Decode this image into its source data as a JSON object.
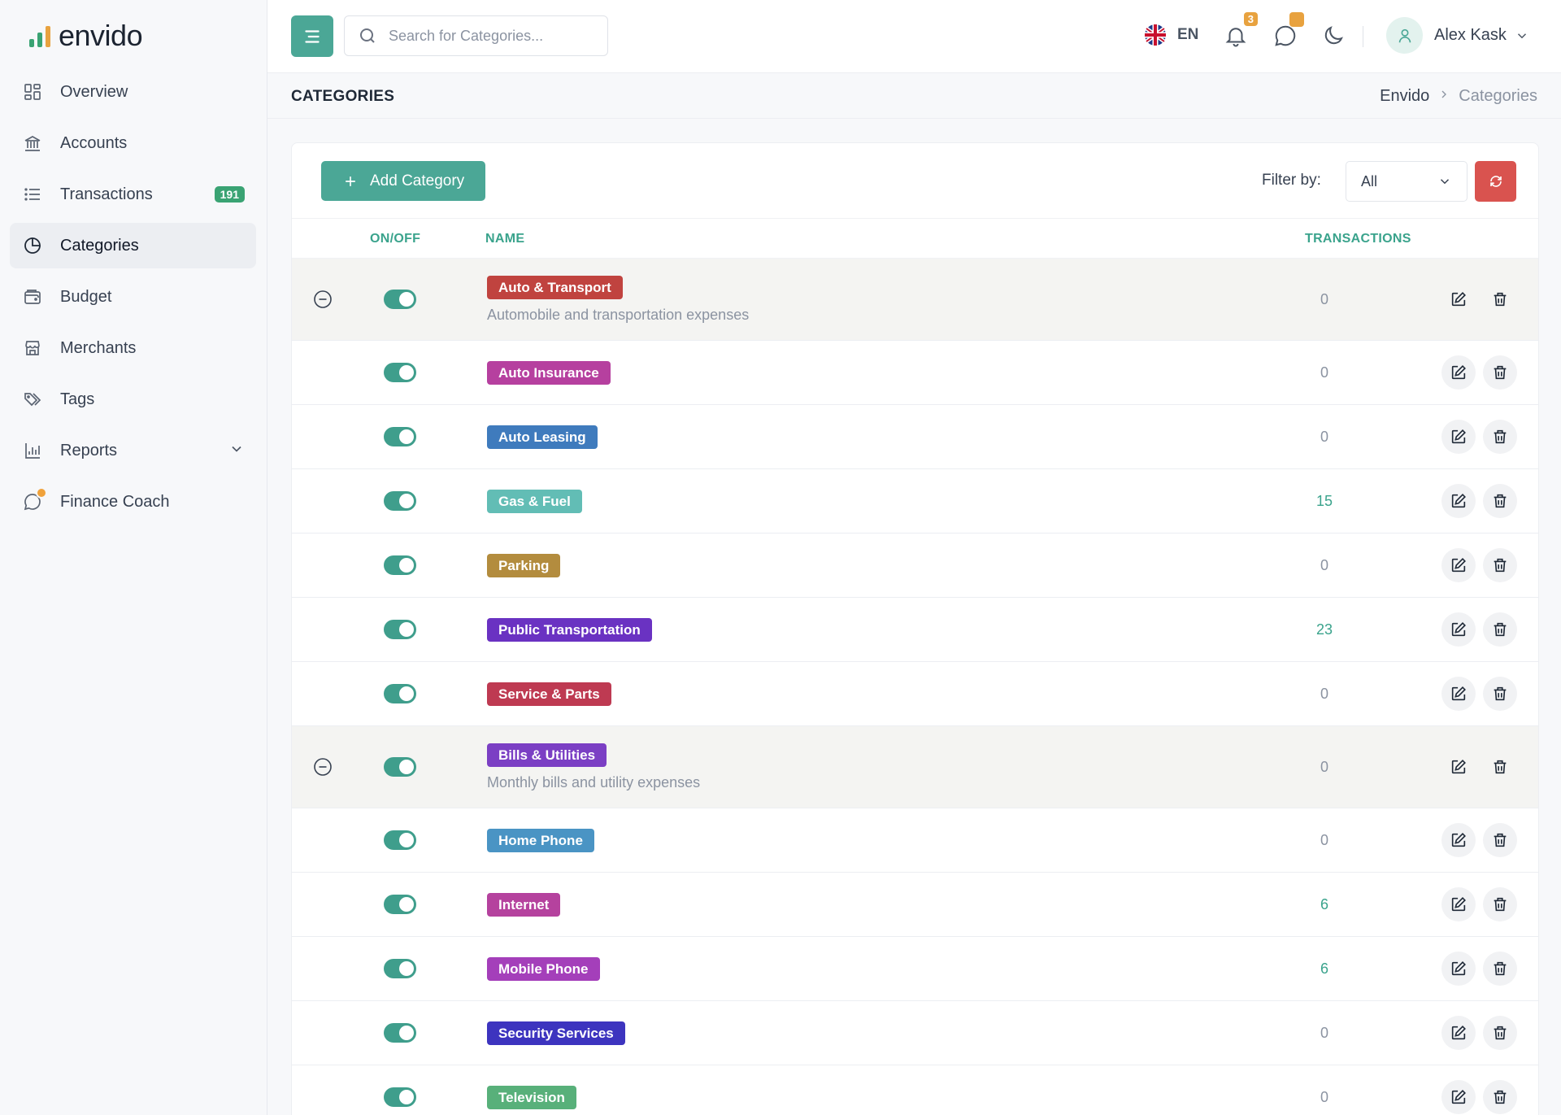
{
  "app": {
    "name": "envido"
  },
  "colors": {
    "accent": "#4ba796",
    "danger": "#d9534f",
    "badge": "#3aa373",
    "warning": "#e8a23f"
  },
  "sidebar": {
    "items": [
      {
        "label": "Overview",
        "icon": "grid-icon"
      },
      {
        "label": "Accounts",
        "icon": "bank-icon"
      },
      {
        "label": "Transactions",
        "icon": "list-icon",
        "badge": "191"
      },
      {
        "label": "Categories",
        "icon": "pie-chart-icon",
        "active": true
      },
      {
        "label": "Budget",
        "icon": "wallet-icon"
      },
      {
        "label": "Merchants",
        "icon": "store-icon"
      },
      {
        "label": "Tags",
        "icon": "tags-icon"
      },
      {
        "label": "Reports",
        "icon": "bar-chart-icon",
        "expandable": true
      },
      {
        "label": "Finance Coach",
        "icon": "chat-icon"
      }
    ]
  },
  "topbar": {
    "search": {
      "placeholder": "Search for Categories..."
    },
    "language": "EN",
    "notifications_count": "3",
    "user_name": "Alex Kask"
  },
  "page": {
    "title": "CATEGORIES",
    "breadcrumb": {
      "home": "Envido",
      "current": "Categories"
    }
  },
  "toolbar": {
    "add_label": "Add Category",
    "filter_label": "Filter by:",
    "filter_value": "All"
  },
  "table": {
    "headers": {
      "onoff": "ON/OFF",
      "name": "NAME",
      "transactions": "TRANSACTIONS"
    },
    "rows": [
      {
        "type": "parent",
        "name": "Auto & Transport",
        "color": "#c0433f",
        "description": "Automobile and transportation expenses",
        "count": "0"
      },
      {
        "type": "child",
        "name": "Auto Insurance",
        "color": "#b6409f",
        "count": "0"
      },
      {
        "type": "child",
        "name": "Auto Leasing",
        "color": "#3f7bbd",
        "count": "0"
      },
      {
        "type": "child",
        "name": "Gas & Fuel",
        "color": "#62bdb5",
        "count": "15"
      },
      {
        "type": "child",
        "name": "Parking",
        "color": "#b38c3e",
        "count": "0"
      },
      {
        "type": "child",
        "name": "Public Transportation",
        "color": "#6a32c2",
        "count": "23"
      },
      {
        "type": "child",
        "name": "Service & Parts",
        "color": "#be3a52",
        "count": "0"
      },
      {
        "type": "parent",
        "name": "Bills & Utilities",
        "color": "#7b3fc4",
        "description": "Monthly bills and utility expenses",
        "count": "0"
      },
      {
        "type": "child",
        "name": "Home Phone",
        "color": "#4a94c4",
        "count": "0"
      },
      {
        "type": "child",
        "name": "Internet",
        "color": "#b5429e",
        "count": "6"
      },
      {
        "type": "child",
        "name": "Mobile Phone",
        "color": "#a43fba",
        "count": "6"
      },
      {
        "type": "child",
        "name": "Security Services",
        "color": "#3d34bf",
        "count": "0"
      },
      {
        "type": "child",
        "name": "Television",
        "color": "#58b07a",
        "count": "0"
      }
    ]
  }
}
